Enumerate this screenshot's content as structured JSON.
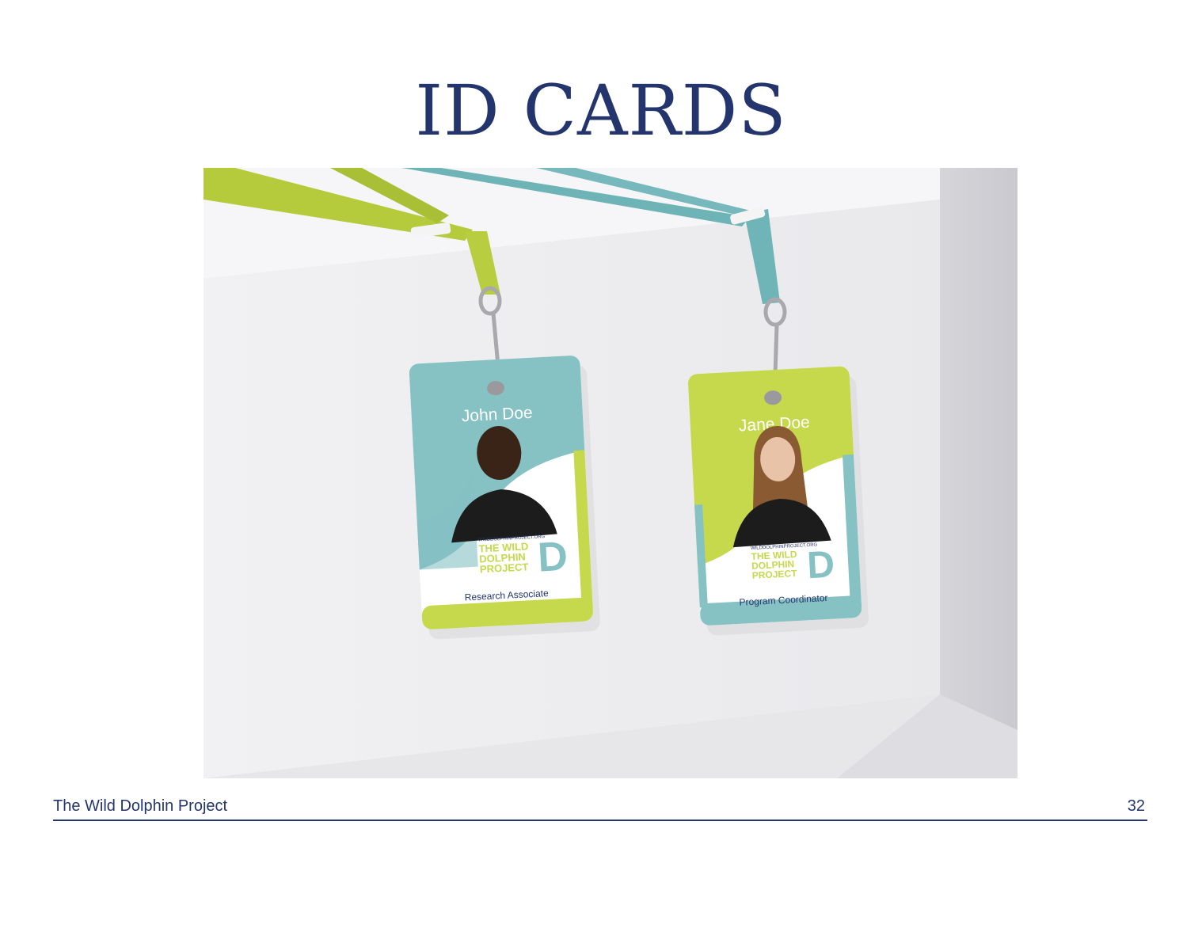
{
  "page": {
    "title": "ID CARDS",
    "footer_left": "The Wild Dolphin Project",
    "page_number": "32"
  },
  "badges": [
    {
      "name": "John Doe",
      "role": "Research Associate",
      "logo_url": "WILDDOLPHINPROJECT.ORG",
      "logo_line1": "THE WILD",
      "logo_line2": "DOLPHIN",
      "logo_line3": "PROJECT",
      "logo_letter": "D",
      "top_color": "#86c1c4",
      "accent_color": "#c6d84b"
    },
    {
      "name": "Jane Doe",
      "role": "Program Coordinator",
      "logo_url": "WILDDOLPHINPROJECT.ORG",
      "logo_line1": "THE WILD",
      "logo_line2": "DOLPHIN",
      "logo_line3": "PROJECT",
      "logo_letter": "D",
      "top_color": "#c6d84b",
      "accent_color": "#86c1c4"
    }
  ],
  "colors": {
    "navy": "#24356e",
    "teal": "#86c1c4",
    "lime": "#c6d84b"
  }
}
